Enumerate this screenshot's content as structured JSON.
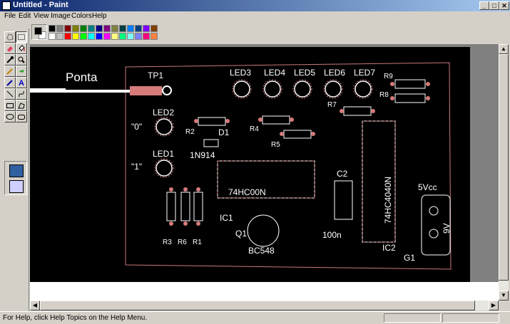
{
  "window": {
    "title": "Untitled - Paint",
    "minimize": "_",
    "maximize": "□",
    "close": "✕"
  },
  "menu": [
    "File",
    "Edit",
    "View",
    "Image",
    "Colors",
    "Help"
  ],
  "palette": {
    "foreground": "#000000",
    "background": "#ffffff",
    "row1": [
      "#000000",
      "#808080",
      "#800000",
      "#808000",
      "#008000",
      "#008080",
      "#000080",
      "#800080",
      "#808040",
      "#004040",
      "#0080ff",
      "#004080",
      "#8000ff",
      "#804000"
    ],
    "row2": [
      "#ffffff",
      "#c0c0c0",
      "#ff0000",
      "#ffff00",
      "#00ff00",
      "#00ffff",
      "#0000ff",
      "#ff00ff",
      "#ffff80",
      "#00ff80",
      "#80ffff",
      "#8080ff",
      "#ff0080",
      "#ff8040"
    ]
  },
  "pcb": {
    "probe_label": "Ponta",
    "tp1": "TP1",
    "leds": [
      "LED3",
      "LED4",
      "LED5",
      "LED6",
      "LED7"
    ],
    "led2": "LED2",
    "led1": "LED1",
    "zero_label": "\"0\"",
    "one_label": "\"1\"",
    "r9": "R9",
    "r8": "R8",
    "r7": "R7",
    "r2": "R2",
    "d1": "D1",
    "r4": "R4",
    "r5": "R5",
    "diode_type": "1N914",
    "ic1_part": "74HC00N",
    "ic1": "IC1",
    "c2": "C2",
    "c2_value": "100n",
    "ic2_part": "74HC4040N",
    "ic2": "IC2",
    "vcc": "5Vcc",
    "battery": "9V",
    "g1": "G1",
    "q1": "Q1",
    "q1_part": "BC548",
    "r3": "R3",
    "r6": "R6",
    "r1": "R1"
  },
  "status": {
    "help_text": "For Help, click Help Topics on the Help Menu."
  }
}
